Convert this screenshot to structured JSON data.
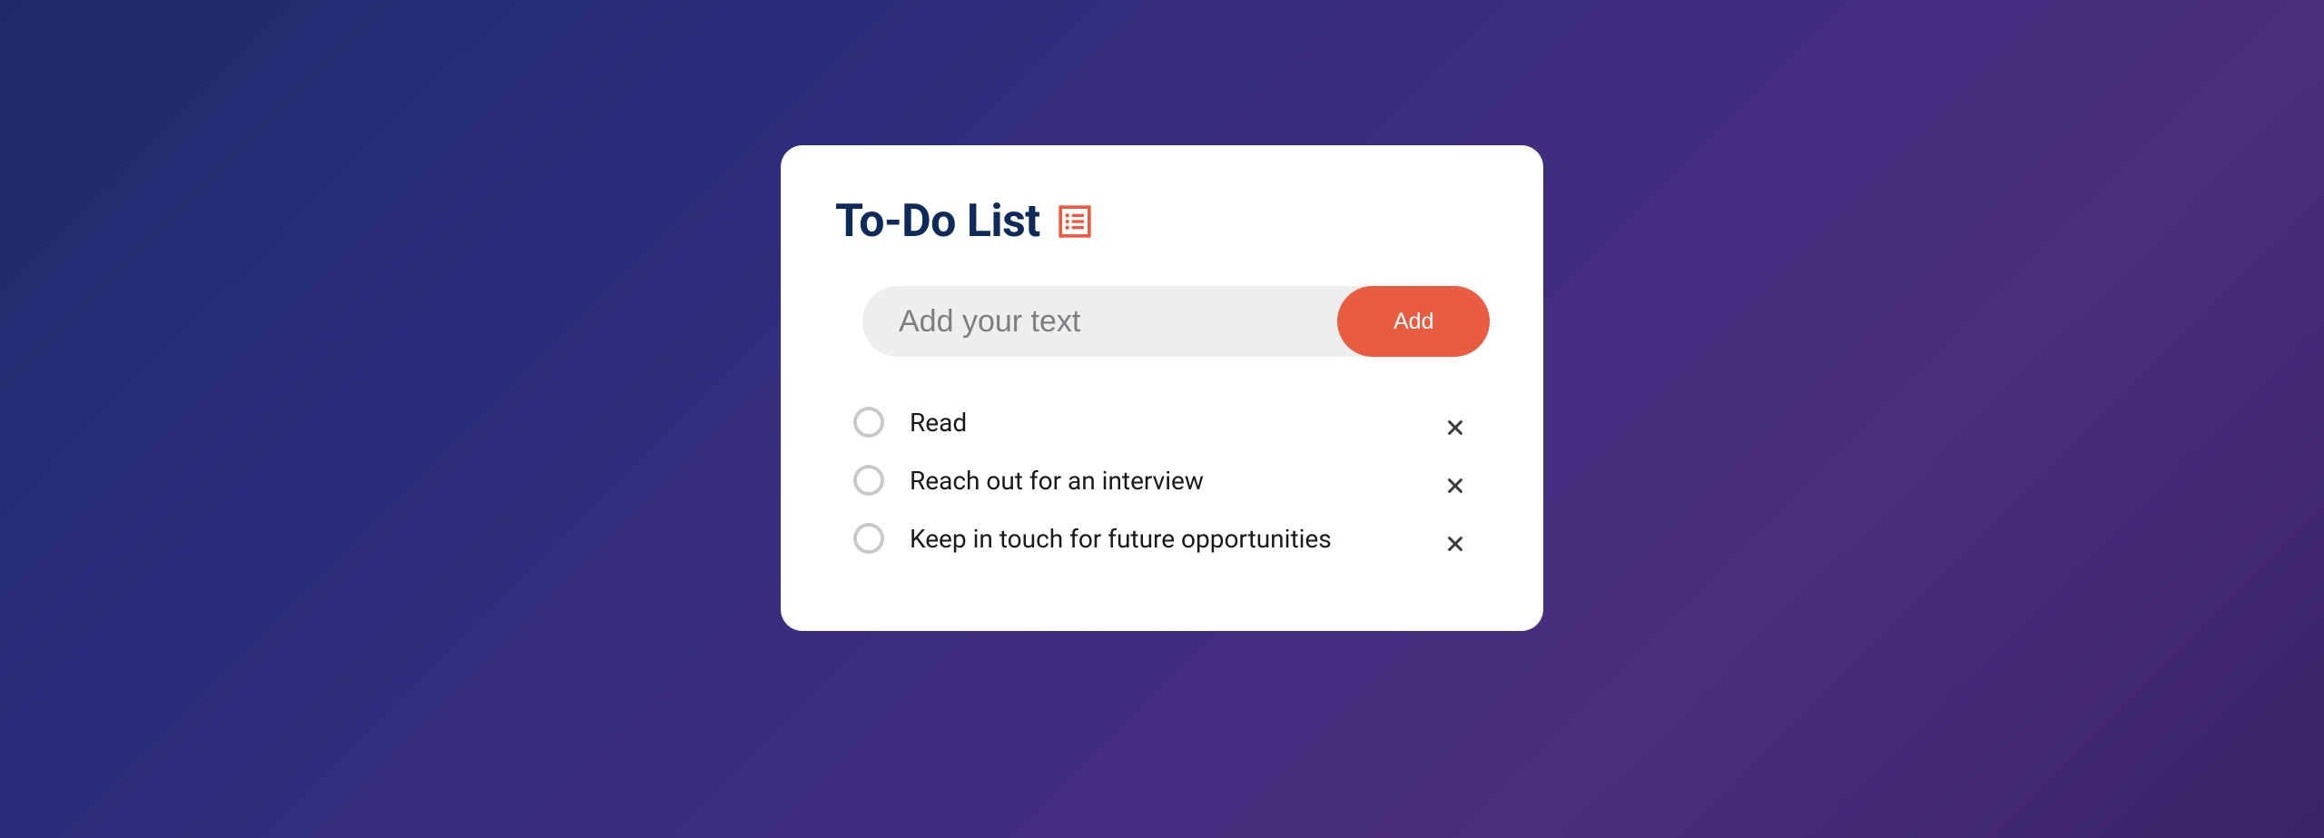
{
  "header": {
    "title": "To-Do List"
  },
  "input": {
    "placeholder": "Add your text",
    "add_label": "Add"
  },
  "items": [
    {
      "text": "Read"
    },
    {
      "text": "Reach out for an interview"
    },
    {
      "text": "Keep in touch for future opportunities"
    }
  ],
  "colors": {
    "accent": "#e85d42",
    "title": "#0e2a5a"
  }
}
